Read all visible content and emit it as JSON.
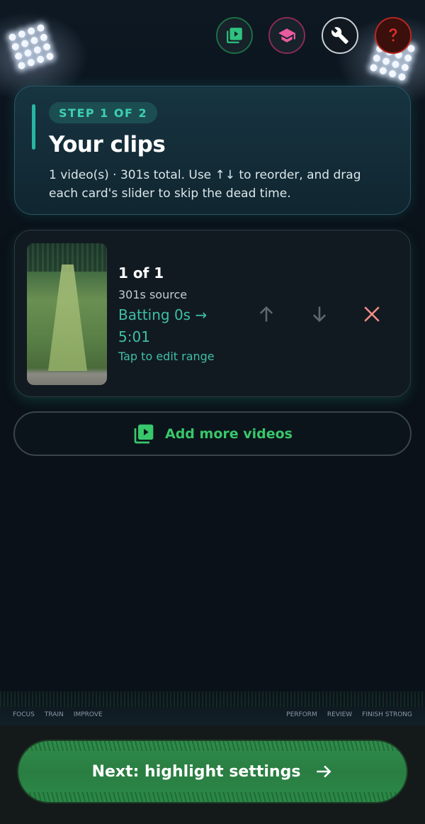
{
  "header": {
    "icons": [
      "video-library-icon",
      "graduation-cap-icon",
      "wrench-icon",
      "help-icon"
    ]
  },
  "step": {
    "pill": "STEP 1 OF 2",
    "title": "Your clips",
    "description": "1 video(s) · 301s total. Use ↑↓ to reorder, and drag each card's slider to skip the dead time."
  },
  "clip": {
    "count": "1 of 1",
    "source": "301s source",
    "range": "Batting 0s → 5:01",
    "edit": "Tap to edit range"
  },
  "add_more": {
    "label": "Add more videos"
  },
  "banner": {
    "left": [
      "FOCUS",
      "TRAIN",
      "IMPROVE"
    ],
    "right": [
      "PERFORM",
      "REVIEW",
      "FINISH STRONG"
    ]
  },
  "next": {
    "label": "Next: highlight settings"
  },
  "colors": {
    "accent_teal": "#3fbfa6",
    "accent_green": "#38c76b",
    "delete_red": "#f08f86",
    "background": "#0a1119"
  }
}
